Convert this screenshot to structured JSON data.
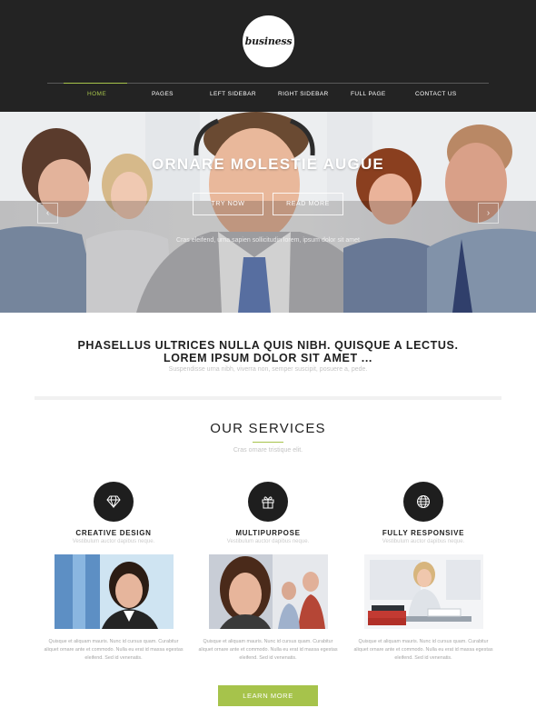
{
  "header": {
    "logo_text": "business",
    "nav": [
      {
        "label": "Home",
        "active": true
      },
      {
        "label": "Pages",
        "active": false
      },
      {
        "label": "Left Sidebar",
        "active": false
      },
      {
        "label": "Right Sidebar",
        "active": false
      },
      {
        "label": "Full Page",
        "active": false
      },
      {
        "label": "Contact Us",
        "active": false
      }
    ]
  },
  "hero": {
    "title": "ORNARE MOLESTIE AUGUE",
    "try_now_label": "Try Now",
    "read_more_label": "Read More",
    "subtitle": "Cras eleifend, urna sapien sollicitudin lorem, ipsum dolor sit amet",
    "prev_icon": "chevron-left-icon",
    "next_icon": "chevron-right-icon"
  },
  "intro": {
    "line1": "PHASELLUS ULTRICES NULLA QUIS NIBH. QUISQUE A LECTUS.",
    "line2": "LOREM IPSUM DOLOR SIT AMET ...",
    "subtitle": "Suspendisse urna nibh, viverra non, semper suscipit, posuere a, pede."
  },
  "services": {
    "title": "OUR SERVICES",
    "subtitle": "Cras ornare tristique elit.",
    "items": [
      {
        "icon": "diamond-icon",
        "title": "CREATIVE DESIGN",
        "subtitle": "Vestibulum auctor dapibus neque.",
        "text": "Quisque et aliquam mauris. Nunc id cursus quam. Curabitur aliquet ornare ante et commodo. Nulla eu erat id massa egestas eleifend. Sed id venenatis."
      },
      {
        "icon": "gift-icon",
        "title": "MULTIPURPOSE",
        "subtitle": "Vestibulum auctor dapibus neque.",
        "text": "Quisque et aliquam mauris. Nunc id cursus quam. Curabitur aliquet ornare ante et commodo. Nulla eu erat id massa egestas eleifend. Sed id venenatis."
      },
      {
        "icon": "globe-icon",
        "title": "FULLY RESPONSIVE",
        "subtitle": "Vestibulum auctor dapibus neque.",
        "text": "Quisque et aliquam mauris. Nunc id cursus quam. Curabitur aliquet ornare ante et commodo. Nulla eu erat id massa egestas eleifend. Sed id venenatis."
      }
    ],
    "learn_more_label": "Learn More"
  },
  "colors": {
    "accent": "#a6c34b",
    "header_bg": "#232323",
    "icon_bg": "#1e1e1e"
  }
}
